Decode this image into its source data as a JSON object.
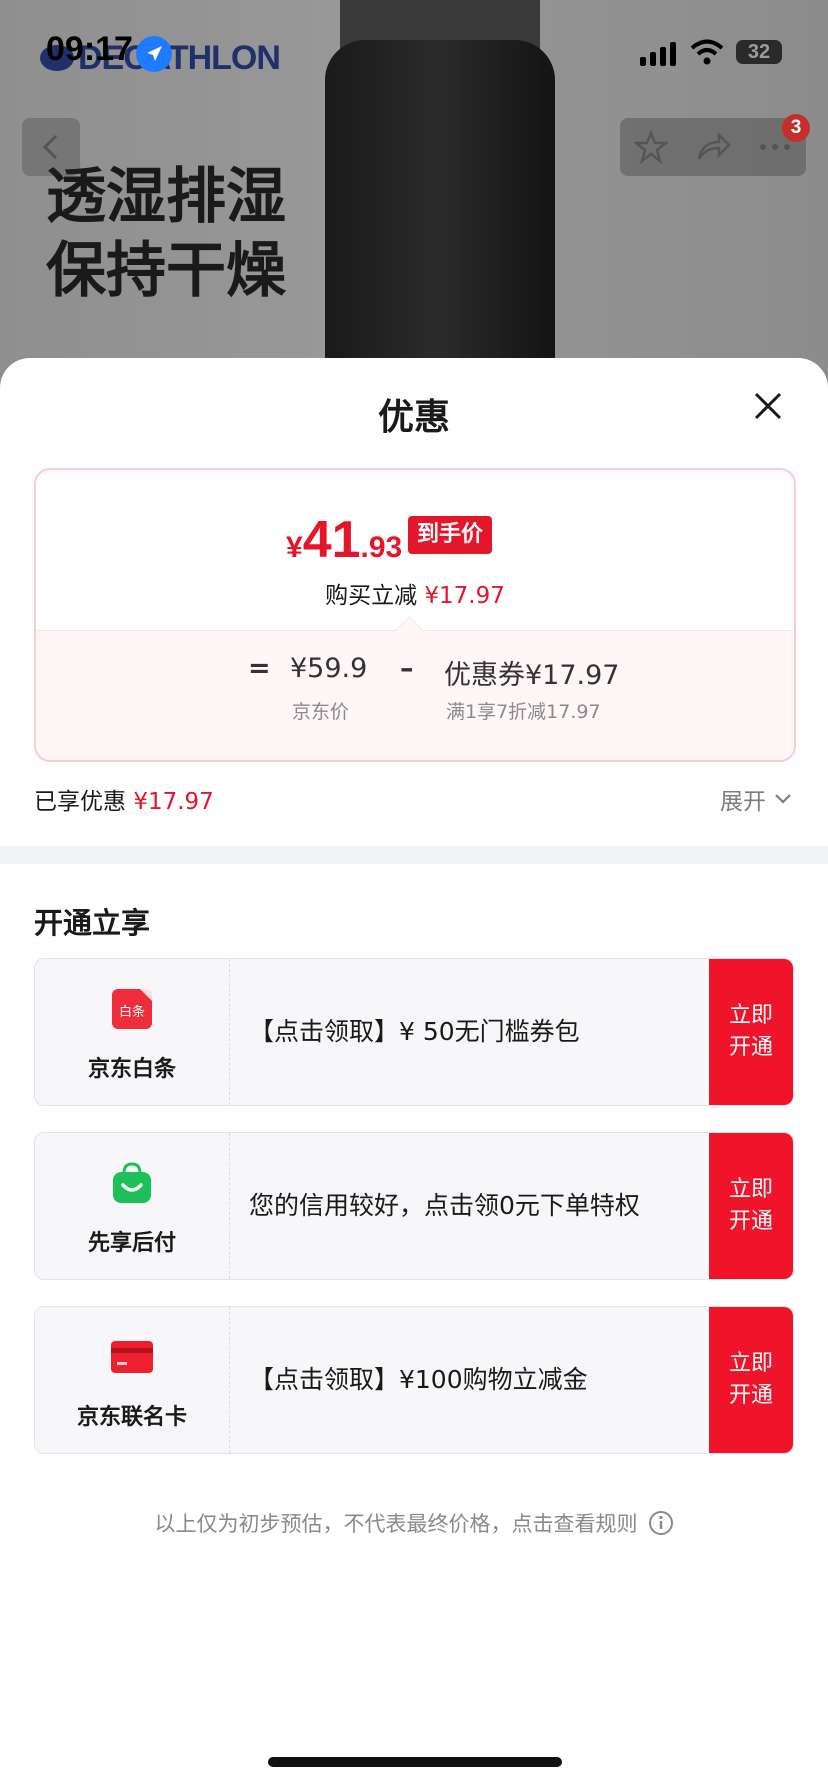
{
  "status_bar": {
    "time": "09:17",
    "battery": "32"
  },
  "backdrop": {
    "brand": "DECATHLON",
    "promo_line1": "透湿排湿",
    "promo_line2": "保持干燥",
    "cart_badge": "3"
  },
  "sheet": {
    "title": "优惠",
    "price": {
      "currency": "¥",
      "integer": "41",
      "decimal": ".93",
      "tag": "到手价",
      "reduce_label": "购买立减",
      "reduce_value": "¥17.97"
    },
    "calc": {
      "equals": "=",
      "base_price": "¥59.9",
      "base_label": "京东价",
      "minus": "–",
      "coupon": "优惠券¥17.97",
      "coupon_label": "满1享7折减17.97"
    },
    "enjoyed_label": "已享优惠",
    "enjoyed_value": "¥17.97",
    "expand_label": "展开",
    "section_title": "开通立享",
    "offers": [
      {
        "name": "京东白条",
        "icon": "baitiao-icon",
        "icon_text": "白条",
        "desc": "【点击领取】¥ 50无门槛券包",
        "btn_line1": "立即",
        "btn_line2": "开通"
      },
      {
        "name": "先享后付",
        "icon": "shopping-bag-icon",
        "desc": "您的信用较好，点击领0元下单特权",
        "btn_line1": "立即",
        "btn_line2": "开通"
      },
      {
        "name": "京东联名卡",
        "icon": "credit-card-icon",
        "desc": "【点击领取】¥100购物立减金",
        "btn_line1": "立即",
        "btn_line2": "开通"
      }
    ],
    "footnote": "以上仅为初步预估，不代表最终价格，点击查看规则"
  },
  "colors": {
    "accent_red": "#e4162a",
    "button_red": "#f0142b",
    "baitiao_green": "#1fbf5a"
  }
}
